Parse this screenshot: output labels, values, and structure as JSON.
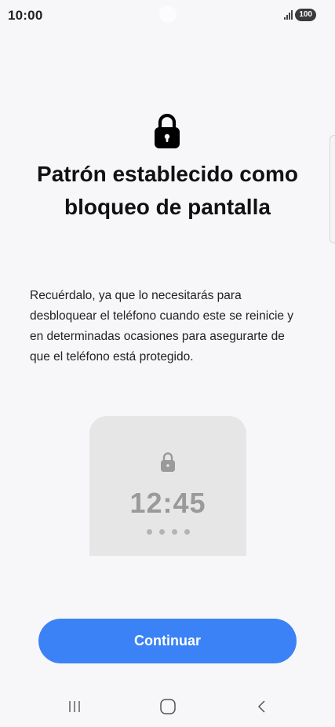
{
  "status_bar": {
    "time": "10:00",
    "battery": "100",
    "icons": [
      "signal-icon",
      "battery-icon"
    ]
  },
  "main": {
    "icon": "lock-icon",
    "title_line1": "Patrón establecido como",
    "title_line2": "bloqueo de pantalla",
    "description": "Recuérdalo, ya que lo necesitarás para desbloquear el teléfono cuando este se reinicie y en determinadas ocasiones para asegurarte de que el teléfono está protegido."
  },
  "preview": {
    "icon": "lock-icon",
    "time": "12:45",
    "dots": 4
  },
  "actions": {
    "continue_label": "Continuar"
  },
  "nav_bar": {
    "icons": [
      "recents-icon",
      "home-icon",
      "back-icon"
    ]
  },
  "colors": {
    "accent": "#3b82f6",
    "background": "#f7f7fa",
    "preview_bg": "#e6e6e6"
  }
}
